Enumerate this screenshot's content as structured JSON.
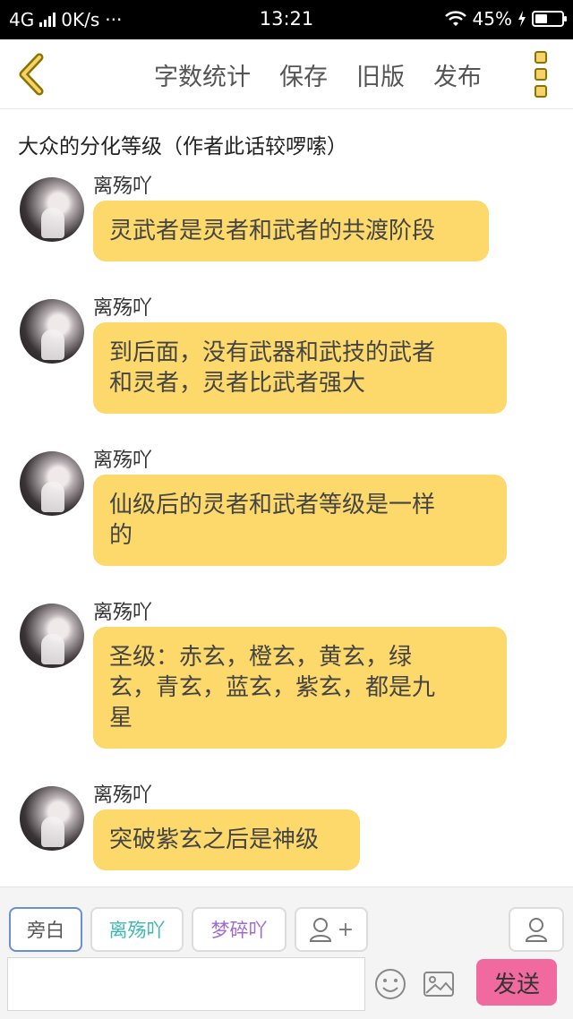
{
  "status_bar": {
    "network": "4G",
    "speed": "0K/s",
    "more_dots": "···",
    "time": "13:21",
    "battery_percent": "45%",
    "battery_level": 0.45
  },
  "toolbar": {
    "word_count": "字数统计",
    "save": "保存",
    "old_version": "旧版",
    "publish": "发布"
  },
  "chapter": {
    "title": "大众的分化等级（作者此话较啰嗦）"
  },
  "messages": [
    {
      "sender": "离殇吖",
      "text": "灵武者是灵者和武者的共渡阶段"
    },
    {
      "sender": "离殇吖",
      "line1": "到后面，没有武器和武技的武者",
      "line2": "和灵者，灵者比武者强大"
    },
    {
      "sender": "离殇吖",
      "line1": "仙级后的灵者和武者等级是一样",
      "line2": "的"
    },
    {
      "sender": "离殇吖",
      "line1": "圣级：赤玄，橙玄，黄玄，绿",
      "line2": "玄，青玄，蓝玄，紫玄，都是九",
      "line3": "星"
    },
    {
      "sender": "离殇吖",
      "text": "突破紫玄之后是神级"
    }
  ],
  "bottom_bar": {
    "roles": [
      {
        "label": "旁白",
        "color": "#555555"
      },
      {
        "label": "离殇吖",
        "color": "#3cb8b0"
      },
      {
        "label": "梦碎吖",
        "color": "#a06ad0"
      }
    ],
    "add_role_plus": "+",
    "input_placeholder": "",
    "send": "发送"
  },
  "colors": {
    "bubble": "#fcd96a",
    "send_button": "#f06aa0",
    "accent_icon": "#f7d26a"
  }
}
